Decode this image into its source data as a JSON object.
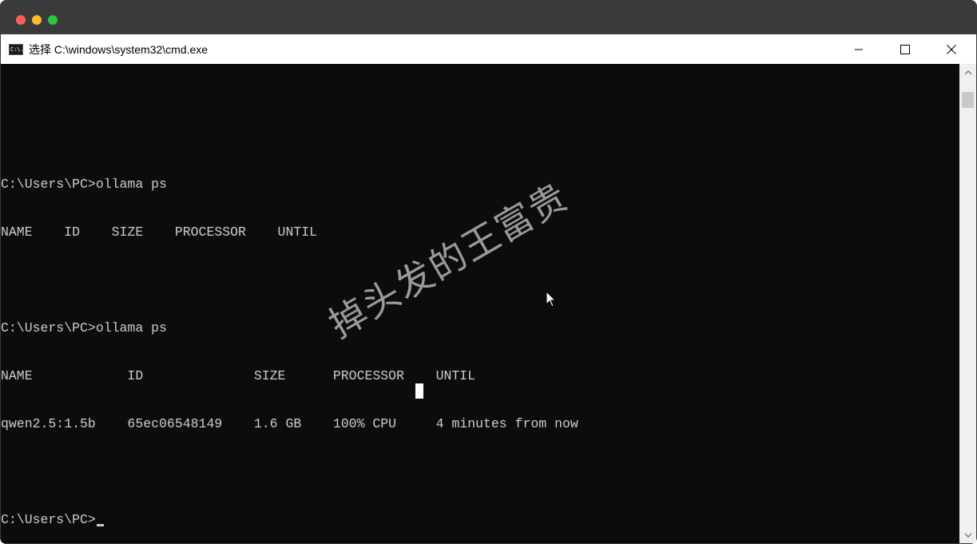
{
  "window": {
    "title": "选择 C:\\windows\\system32\\cmd.exe",
    "icon": "cmd-icon",
    "icon_text": "C:\\.",
    "controls": [
      "minimize-icon",
      "maximize-icon",
      "close-icon"
    ]
  },
  "console": {
    "lines": [
      "",
      "C:\\Users\\PC>ollama ps",
      "NAME    ID    SIZE    PROCESSOR    UNTIL",
      "",
      "C:\\Users\\PC>ollama ps",
      "NAME            ID              SIZE      PROCESSOR    UNTIL",
      "qwen2.5:1.5b    65ec06548149    1.6 GB    100% CPU     4 minutes from now",
      "",
      "C:\\Users\\PC>"
    ],
    "text_color": "#cccccc",
    "background": "#0c0c0c"
  },
  "watermark": {
    "text": "掉头发的王富贵"
  },
  "colors": {
    "mac_close": "#ff5f57",
    "mac_minimize": "#febc2e",
    "mac_zoom": "#28c840"
  }
}
